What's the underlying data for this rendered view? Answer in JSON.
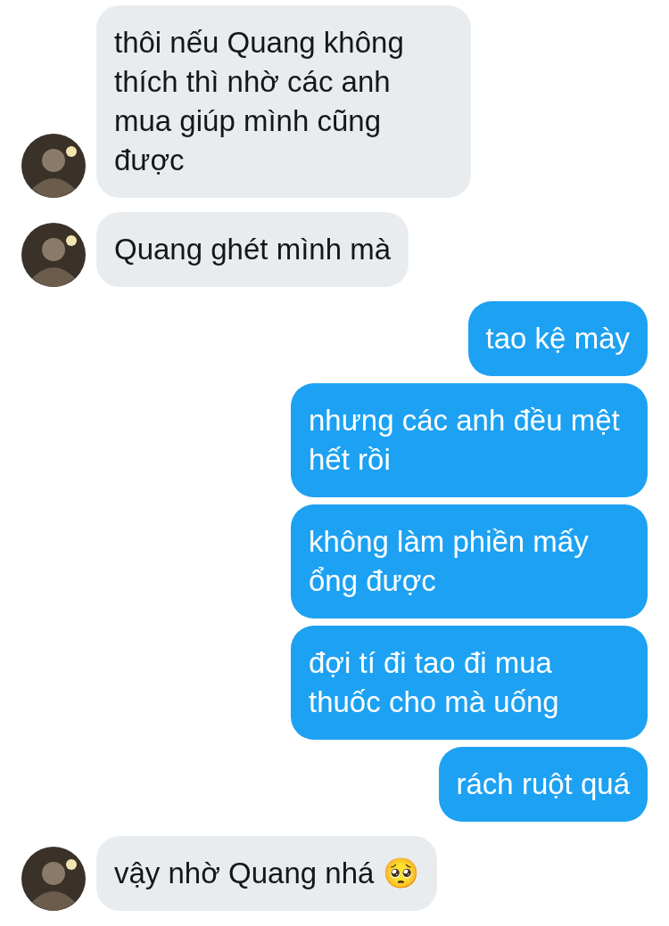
{
  "messages": [
    {
      "kind": "received",
      "text": "thôi nếu Quang không thích thì nhờ các anh mua giúp mình cũng được",
      "avatar": true
    },
    {
      "kind": "received",
      "text": "Quang ghét mình mà",
      "avatar": true
    },
    {
      "kind": "sent",
      "text": "tao kệ mày"
    },
    {
      "kind": "sent",
      "text": "nhưng các anh đều mệt hết rồi"
    },
    {
      "kind": "sent",
      "text": "không làm phiền mấy ổng được"
    },
    {
      "kind": "sent",
      "text": "đợi tí đi tao đi mua thuốc cho mà uống"
    },
    {
      "kind": "sent",
      "text": "rách ruột quá"
    },
    {
      "kind": "received",
      "text": "vậy nhờ Quang nhá 🥺",
      "avatar": true
    }
  ]
}
